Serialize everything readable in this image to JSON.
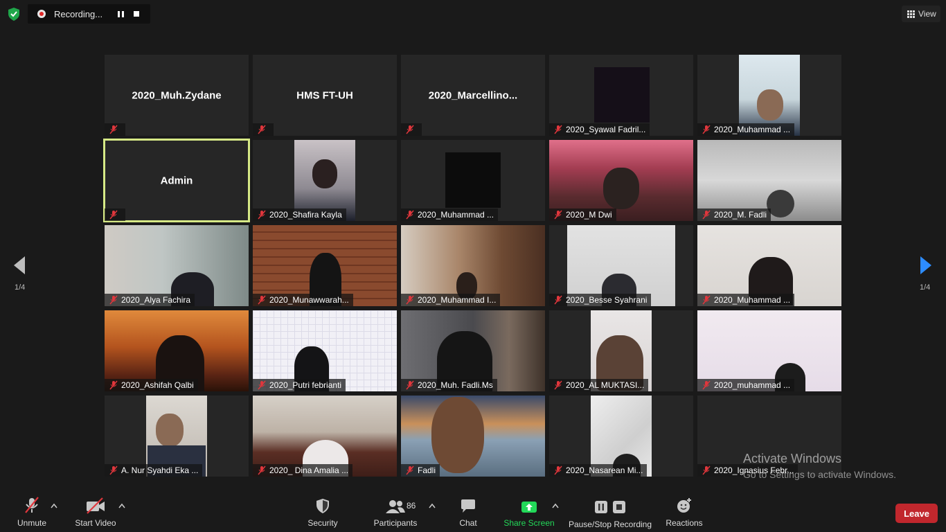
{
  "top_bar": {
    "recording_label": "Recording...",
    "view_label": "View"
  },
  "navigation": {
    "left_page": "1/4",
    "right_page": "1/4"
  },
  "tiles": [
    {
      "name": "2020_Muh.Zydane",
      "center_name": "2020_Muh.Zydane",
      "muted": true
    },
    {
      "name": "HMS FT-UH",
      "center_name": "HMS FT-UH",
      "muted": true
    },
    {
      "name": "2020_Marcellino...",
      "center_name": "2020_Marcellino...",
      "muted": true
    },
    {
      "name": "2020_Syawal Fadril...",
      "muted": true
    },
    {
      "name": "2020_Muhammad ...",
      "muted": true
    },
    {
      "name": "Admin",
      "center_name": "Admin",
      "muted": true,
      "active": true
    },
    {
      "name": "2020_Shafira Kayla",
      "muted": true
    },
    {
      "name": "2020_Muhammad ...",
      "muted": true
    },
    {
      "name": "2020_M Dwi",
      "muted": true
    },
    {
      "name": "2020_M. Fadli",
      "muted": true
    },
    {
      "name": "2020_Alya Fachira",
      "muted": true
    },
    {
      "name": "2020_Munawwarah...",
      "muted": true
    },
    {
      "name": "2020_Muhammad I...",
      "muted": true
    },
    {
      "name": "2020_Besse Syahrani",
      "muted": true
    },
    {
      "name": "2020_Muhammad ...",
      "muted": true
    },
    {
      "name": "2020_Ashifah Qalbi",
      "muted": true
    },
    {
      "name": "2020_Putri febrianti",
      "muted": true
    },
    {
      "name": "2020_Muh. Fadli.Ms",
      "muted": true
    },
    {
      "name": "2020_AL MUKTASI...",
      "muted": true
    },
    {
      "name": "2020_muhammad ...",
      "muted": true
    },
    {
      "name": "A. Nur Syahdi Eka ...",
      "muted": true
    },
    {
      "name": "2020_ Dina Amalia ...",
      "muted": true
    },
    {
      "name": "Fadli",
      "muted": true
    },
    {
      "name": "2020_Nasarean Mi...",
      "muted": true
    },
    {
      "name": "2020_Ignasius Febr...",
      "muted": true
    }
  ],
  "watermark": {
    "line1": "Activate Windows",
    "line2": "Go to Settings to activate Windows."
  },
  "toolbar": {
    "unmute": "Unmute",
    "start_video": "Start Video",
    "security": "Security",
    "participants": "Participants",
    "participants_count": "86",
    "chat": "Chat",
    "share_screen": "Share Screen",
    "pause_stop_recording": "Pause/Stop Recording",
    "reactions": "Reactions",
    "leave": "Leave"
  },
  "colors": {
    "share_green": "#23d959",
    "leave_red": "#c1272d",
    "muted_red": "#e0363c",
    "active_outline": "#d6e986",
    "next_arrow": "#2d8cff"
  }
}
